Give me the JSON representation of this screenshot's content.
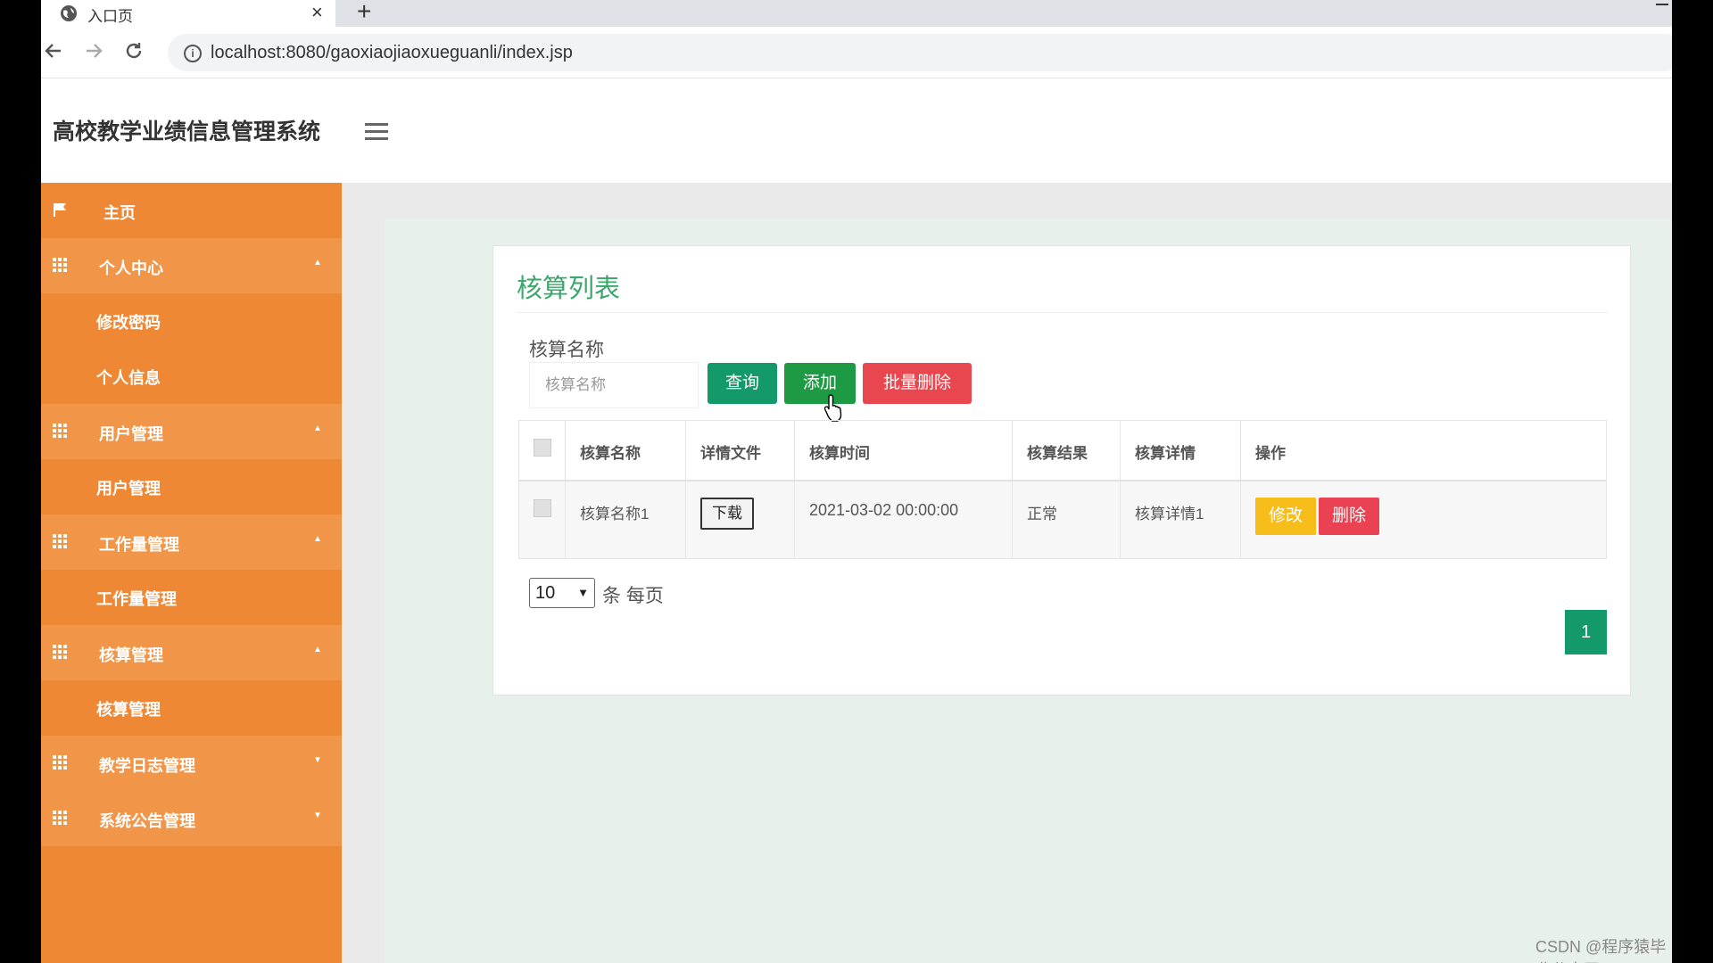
{
  "browser": {
    "tab_title": "入口页",
    "tab_close": "×",
    "new_tab": "+",
    "url": "localhost:8080/gaoxiaojiaoxueguanli/index.jsp"
  },
  "app": {
    "title": "高校教学业绩信息管理系统"
  },
  "sidebar": {
    "items": [
      {
        "label": "主页"
      },
      {
        "label": "个人中心"
      },
      {
        "label": "修改密码"
      },
      {
        "label": "个人信息"
      },
      {
        "label": "用户管理"
      },
      {
        "label": "用户管理"
      },
      {
        "label": "工作量管理"
      },
      {
        "label": "工作量管理"
      },
      {
        "label": "核算管理"
      },
      {
        "label": "核算管理"
      },
      {
        "label": "教学日志管理"
      },
      {
        "label": "系统公告管理"
      }
    ],
    "colors": {
      "background": "#ef8835",
      "group": "#f19549"
    }
  },
  "panel": {
    "title": "核算列表",
    "search_label": "核算名称",
    "search_placeholder": "核算名称",
    "query_button": "查询",
    "add_button": "添加",
    "batch_delete_button": "批量删除"
  },
  "table": {
    "columns": [
      "核算名称",
      "详情文件",
      "核算时间",
      "核算结果",
      "核算详情",
      "操作"
    ],
    "rows": [
      {
        "name": "核算名称1",
        "file_button": "下载",
        "time": "2021-03-02 00:00:00",
        "result": "正常",
        "detail": "核算详情1",
        "edit_button": "修改",
        "delete_button": "删除"
      }
    ]
  },
  "pagination": {
    "page_size": "10",
    "page_size_label": "条 每页",
    "current_page": "1"
  },
  "watermark": "CSDN @程序猿毕业分享网",
  "colors": {
    "accent": "#14996a",
    "title_green": "#3aa86b",
    "danger": "#e9474f",
    "warning": "#f7bd1b"
  }
}
